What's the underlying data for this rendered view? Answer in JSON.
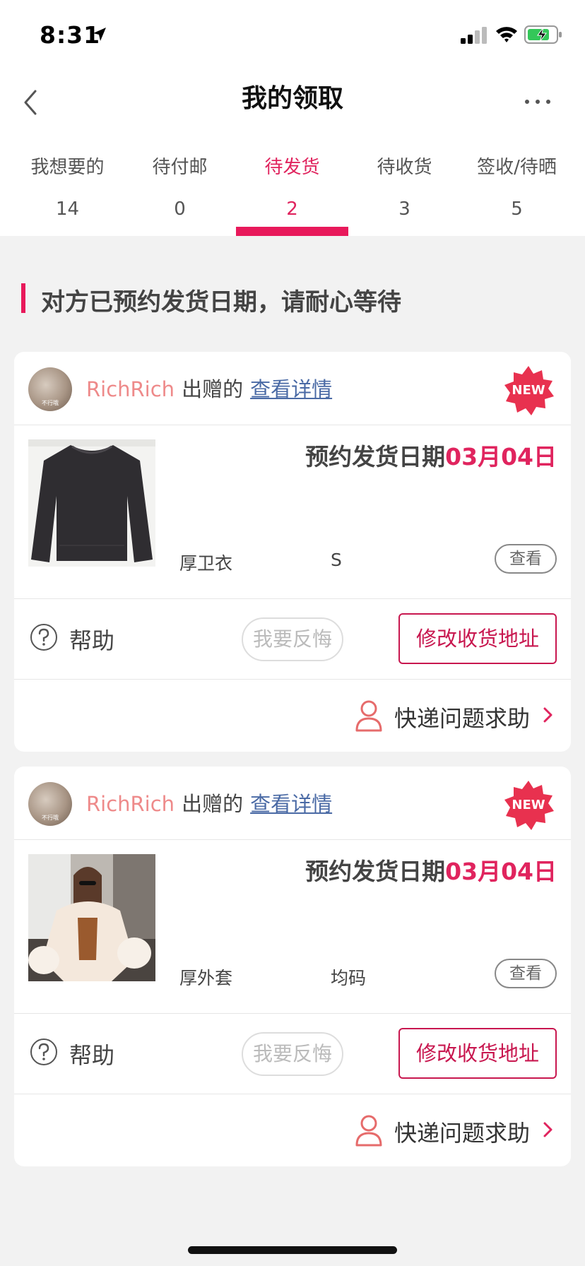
{
  "status_bar": {
    "time": "8:31"
  },
  "nav": {
    "title": "我的领取"
  },
  "tabs": [
    {
      "label": "我想要的",
      "count": "14",
      "active": false
    },
    {
      "label": "待付邮",
      "count": "0",
      "active": false
    },
    {
      "label": "待发货",
      "count": "2",
      "active": true
    },
    {
      "label": "待收货",
      "count": "3",
      "active": false
    },
    {
      "label": "签收/待晒",
      "count": "5",
      "active": false
    }
  ],
  "notice": "对方已预约发货日期，请耐心等待",
  "colors": {
    "accent": "#e8195b",
    "giver": "#ee8a8a",
    "link": "#4a6aa5"
  },
  "cards": [
    {
      "avatar_caption": "不行哦",
      "giver": "RichRich",
      "verb": "出赠的",
      "detail_link": "查看详情",
      "badge": "NEW",
      "ship_prefix": "预约发货日期",
      "ship_date": "03月04日",
      "item_name": "厚卫衣",
      "item_size": "S",
      "view_label": "查看",
      "help_label": "帮助",
      "regret_label": "我要反悔",
      "address_label": "修改收货地址",
      "express_label": "快递问题求助"
    },
    {
      "avatar_caption": "不行哦",
      "giver": "RichRich",
      "verb": "出赠的",
      "detail_link": "查看详情",
      "badge": "NEW",
      "ship_prefix": "预约发货日期",
      "ship_date": "03月04日",
      "item_name": "厚外套",
      "item_size": "均码",
      "view_label": "查看",
      "help_label": "帮助",
      "regret_label": "我要反悔",
      "address_label": "修改收货地址",
      "express_label": "快递问题求助"
    }
  ]
}
